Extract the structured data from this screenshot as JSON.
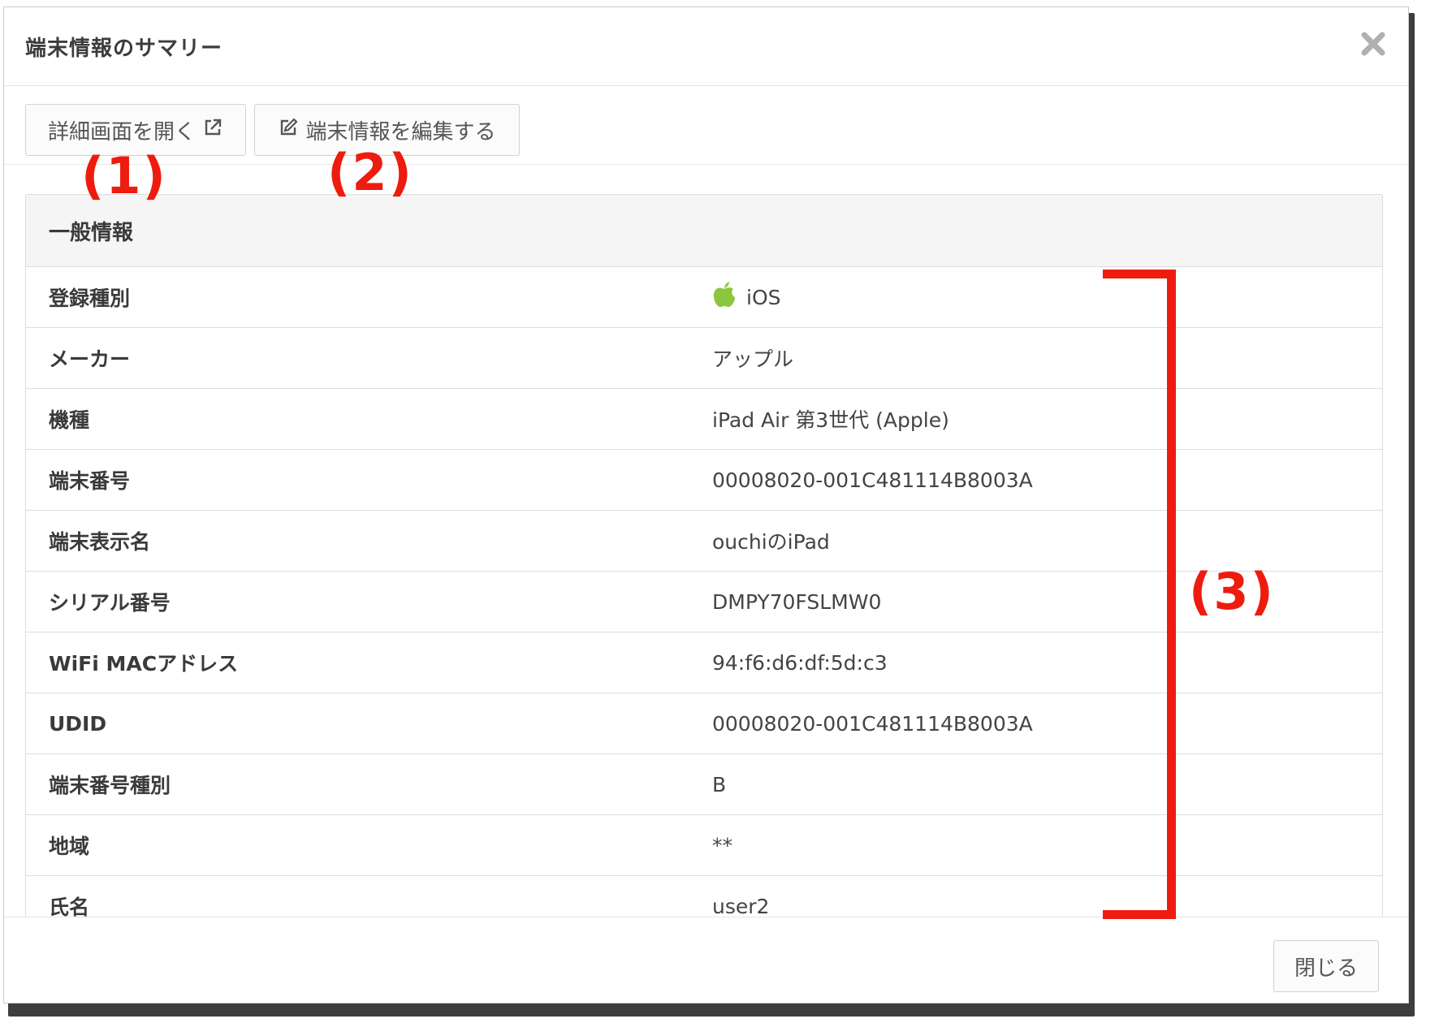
{
  "dialog": {
    "title": "端末情報のサマリー",
    "close_icon": "close-x-icon"
  },
  "toolbar": {
    "open_detail_label": "詳細画面を開く",
    "open_detail_icon": "external-link-icon",
    "edit_label": "端末情報を編集する",
    "edit_icon": "edit-icon"
  },
  "panel": {
    "heading": "一般情報",
    "rows": [
      {
        "label": "登録種別",
        "value": "iOS",
        "icon": "apple-icon"
      },
      {
        "label": "メーカー",
        "value": "アップル"
      },
      {
        "label": "機種",
        "value": "iPad Air 第3世代 (Apple)"
      },
      {
        "label": "端末番号",
        "value": "00008020-001C481114B8003A"
      },
      {
        "label": "端末表示名",
        "value": "ouchiのiPad"
      },
      {
        "label": "シリアル番号",
        "value": "DMPY70FSLMW0"
      },
      {
        "label": "WiFi MACアドレス",
        "value": "94:f6:d6:df:5d:c3"
      },
      {
        "label": "UDID",
        "value": "00008020-001C481114B8003A"
      },
      {
        "label": "端末番号種別",
        "value": "B"
      },
      {
        "label": "地域",
        "value": "**"
      },
      {
        "label": "氏名",
        "value": "user2"
      }
    ]
  },
  "footer": {
    "close_label": "閉じる"
  },
  "annotations": {
    "one": "(1)",
    "two": "(2)",
    "three": "(3)"
  },
  "colors": {
    "annotation": "#ee1c0e",
    "apple_icon": "#8cc63f"
  }
}
